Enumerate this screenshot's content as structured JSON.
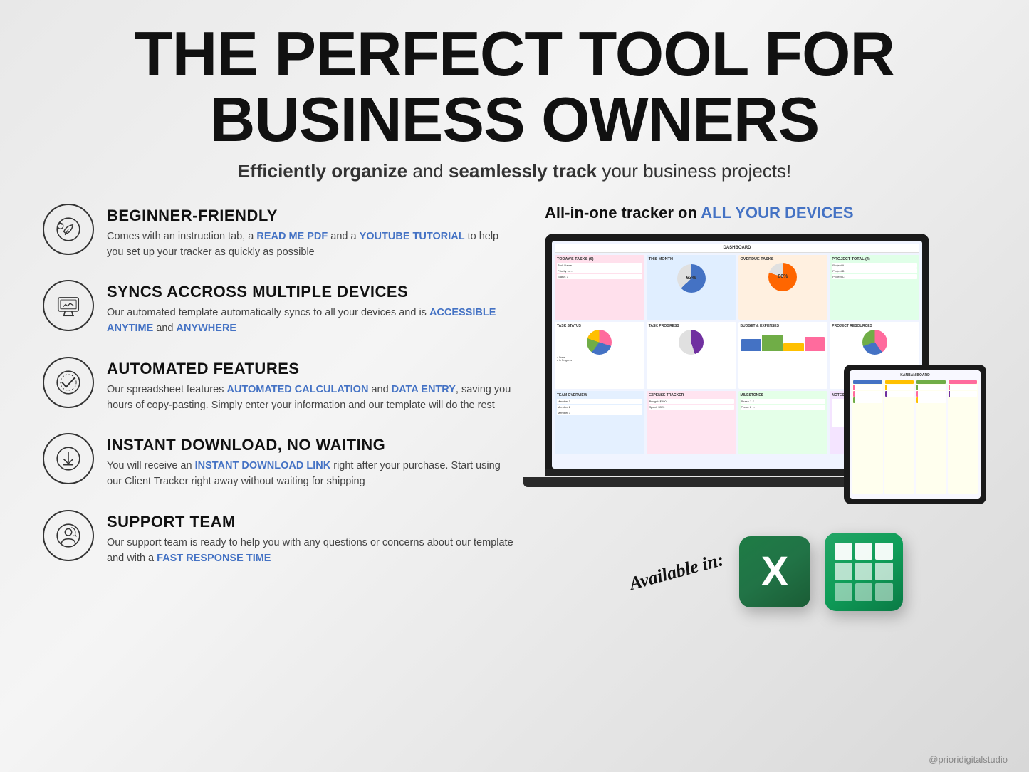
{
  "header": {
    "main_title": "THE PERFECT TOOL FOR\nBUSINESS OWNERS",
    "main_title_line1": "THE PERFECT TOOL FOR",
    "main_title_line2": "BUSINESS OWNERS",
    "subtitle_prefix": "Efficiently organize",
    "subtitle_middle": " and ",
    "subtitle_bold2": "seamlessly track",
    "subtitle_suffix": " your business projects!"
  },
  "right_column": {
    "devices_title_prefix": "All-in-one tracker on ",
    "devices_title_accent": "ALL YOUR DEVICES"
  },
  "available": {
    "label": "Available in:"
  },
  "features": [
    {
      "id": "beginner-friendly",
      "title": "BEGINNER-FRIENDLY",
      "desc_prefix": "Comes with an instruction tab, a ",
      "highlight1": "READ ME PDF",
      "desc_middle": " and a ",
      "highlight2": "YOUTUBE TUTORIAL",
      "desc_suffix": " to help you set up your tracker as quickly as possible",
      "icon": "leaf"
    },
    {
      "id": "syncs-devices",
      "title": "SYNCS ACCROSS MULTIPLE DEVICES",
      "desc_prefix": "Our automated template automatically syncs to all your devices and is ",
      "highlight1": "ACCESSIBLE ANYTIME",
      "desc_middle": " and ",
      "highlight2": "ANYWHERE",
      "desc_suffix": "",
      "icon": "monitor"
    },
    {
      "id": "automated-features",
      "title": "AUTOMATED FEATURES",
      "desc_prefix": "Our spreadsheet features ",
      "highlight1": "AUTOMATED CALCULATION",
      "desc_middle": " and ",
      "highlight2": "DATA ENTRY",
      "desc_suffix": ", saving you hours of copy-pasting. Simply enter your information and our template will do the rest",
      "icon": "checkmark"
    },
    {
      "id": "instant-download",
      "title": "INSTANT DOWNLOAD, NO WAITING",
      "desc_prefix": "You will receive an ",
      "highlight1": "INSTANT DOWNLOAD LINK",
      "desc_middle": " right after your purchase. Start using our Client Tracker right away without waiting for shipping",
      "highlight2": "",
      "desc_suffix": "",
      "icon": "download"
    },
    {
      "id": "support-team",
      "title": "SUPPORT TEAM",
      "desc_prefix": "Our support team is ready to help you with any questions or concerns about our template and with a ",
      "highlight1": "FAST RESPONSE TIME",
      "desc_middle": "",
      "highlight2": "",
      "desc_suffix": "",
      "icon": "person"
    }
  ],
  "footer": {
    "handle": "@prioridigitalstudio"
  },
  "colors": {
    "highlight_blue": "#4472C4",
    "title_color": "#111111",
    "desc_color": "#444444",
    "icon_border": "#333333"
  }
}
